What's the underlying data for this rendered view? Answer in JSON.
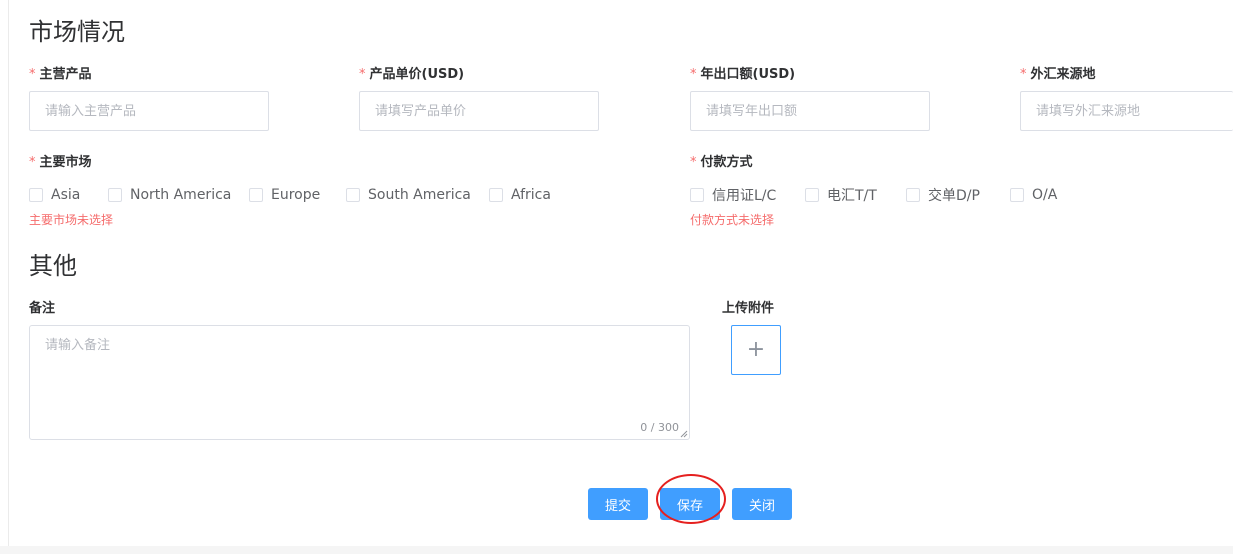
{
  "market_section": {
    "title": "市场情况",
    "required_mark": "*",
    "main_product": {
      "label": "主营产品",
      "placeholder": "请输入主营产品"
    },
    "unit_price": {
      "label": "产品单价(USD)",
      "placeholder": "请填写产品单价"
    },
    "annual_export": {
      "label": "年出口额(USD)",
      "placeholder": "请填写年出口额"
    },
    "forex_source": {
      "label": "外汇来源地",
      "placeholder": "请填写外汇来源地"
    },
    "main_markets": {
      "label": "主要市场",
      "options": [
        "Asia",
        "North America",
        "Europe",
        "South America",
        "Africa"
      ],
      "error": "主要市场未选择"
    },
    "payment_methods": {
      "label": "付款方式",
      "options": [
        "信用证L/C",
        "电汇T/T",
        "交单D/P",
        "O/A"
      ],
      "error": "付款方式未选择"
    }
  },
  "other_section": {
    "title": "其他",
    "remark": {
      "label": "备注",
      "placeholder": "请输入备注",
      "counter": "0 / 300"
    },
    "upload": {
      "label": "上传附件",
      "plus": "+"
    }
  },
  "actions": {
    "submit": "提交",
    "save": "保存",
    "close": "关闭"
  },
  "colors": {
    "primary": "#409eff",
    "required": "#f56c6c",
    "highlight": "#e5201f"
  }
}
